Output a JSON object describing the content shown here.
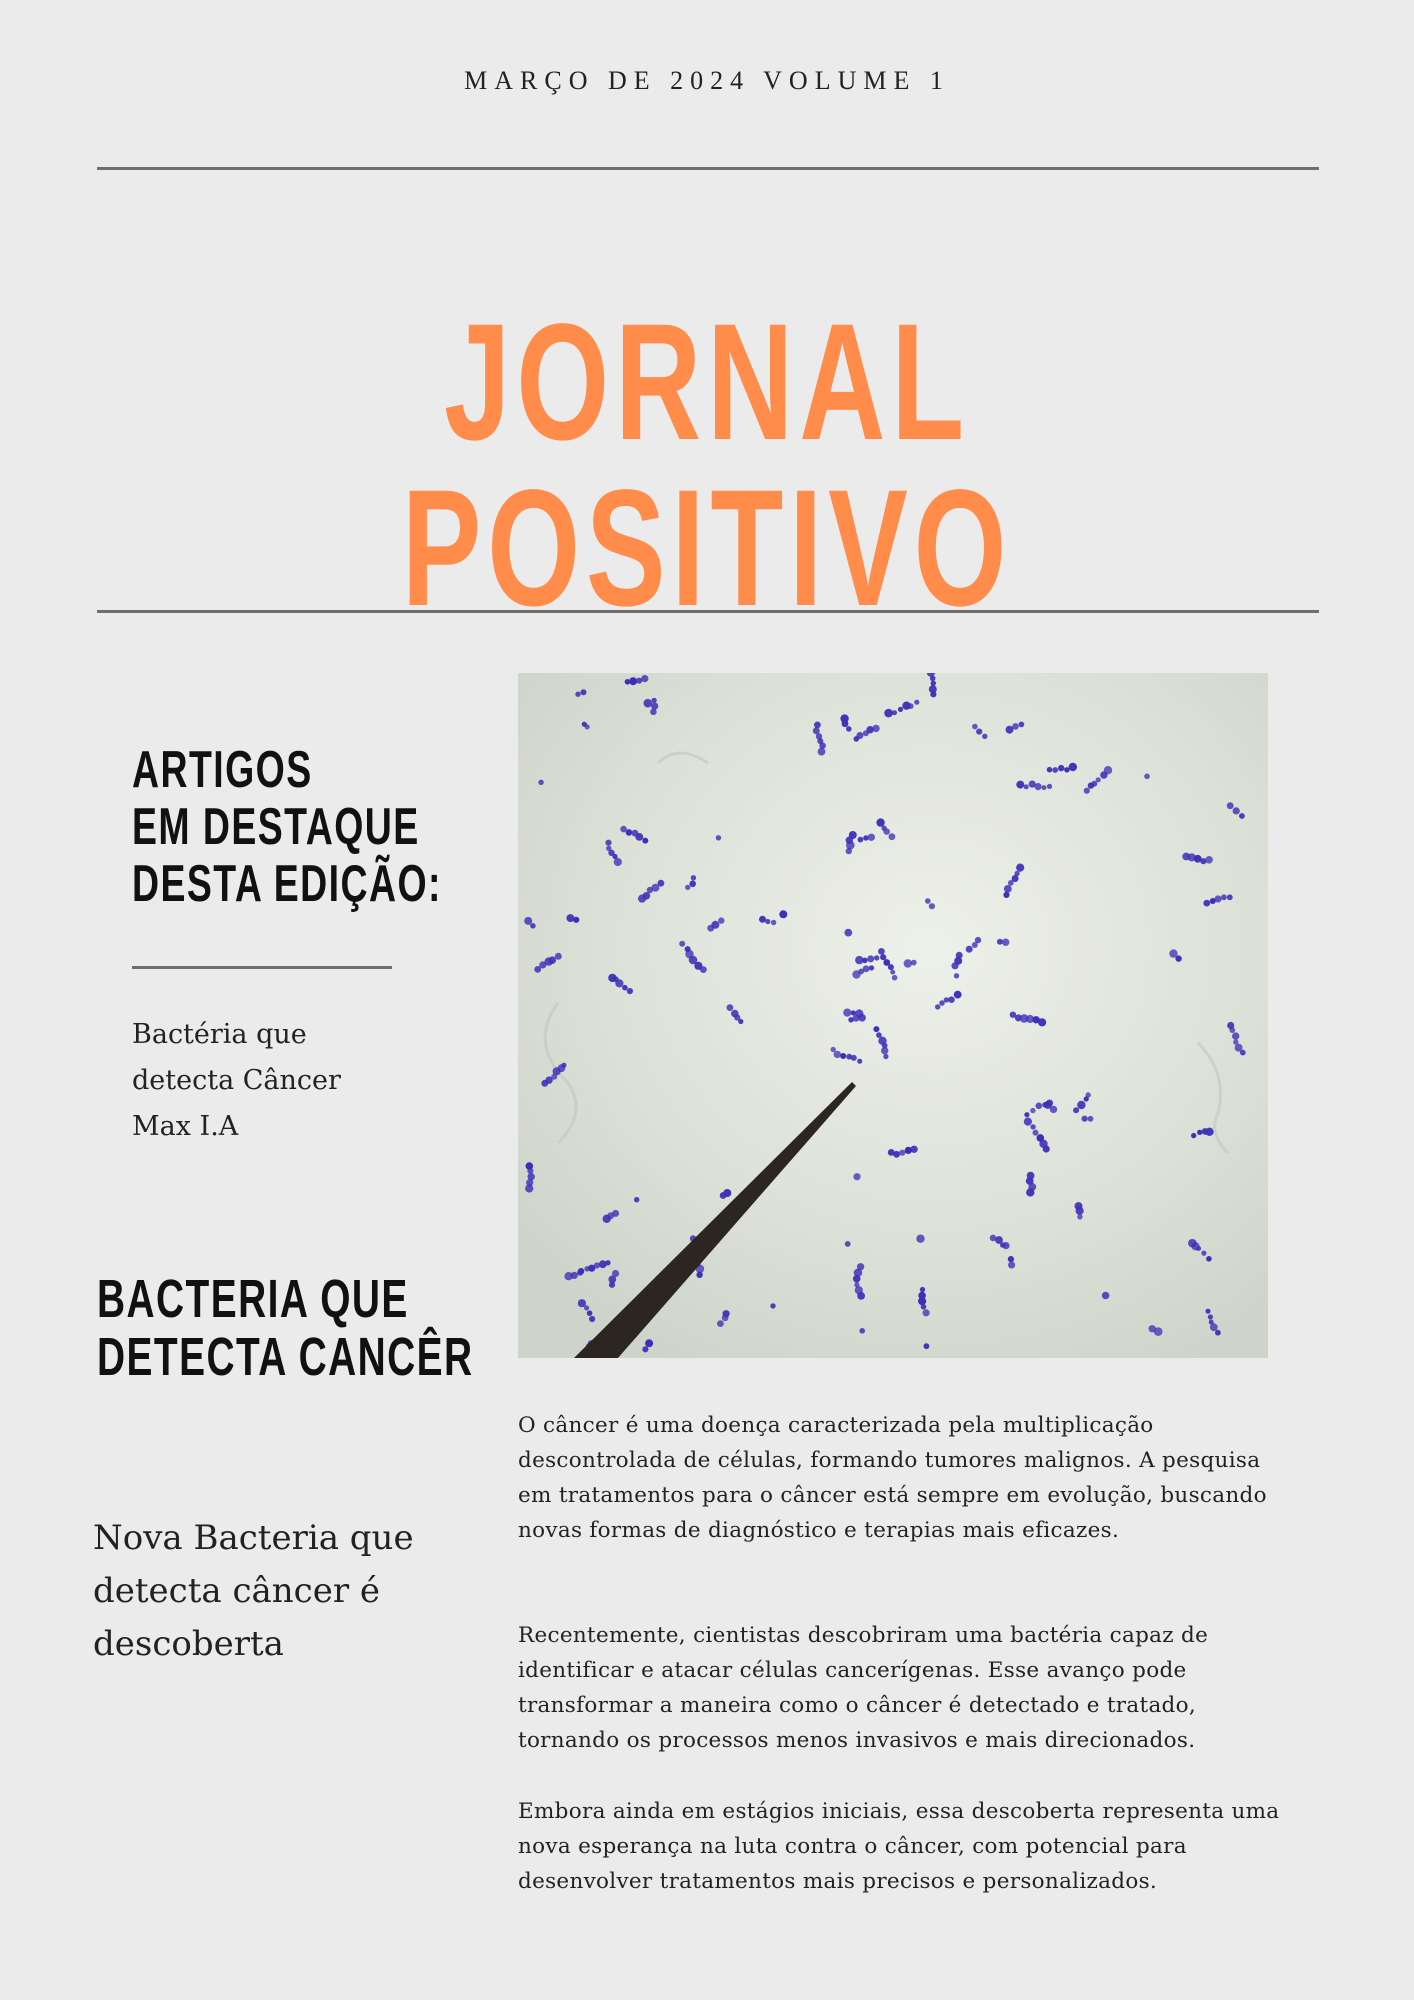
{
  "issue_line": "MARÇO DE 2024 VOLUME 1",
  "masthead": "JORNAL POSITIVO",
  "featured": {
    "heading": [
      "ARTIGOS",
      "EM DESTAQUE",
      "DESTA EDIÇÃO:"
    ],
    "items": [
      "Bactéria que",
      "detecta Câncer",
      "Max I.A"
    ]
  },
  "article": {
    "heading": [
      "BACTERIA QUE",
      "DETECTA CANCÊR"
    ],
    "subtitle": "Nova Bacteria que detecta câncer é descoberta",
    "paragraphs": [
      "O câncer é uma doença caracterizada pela multiplicação descontrolada de células, formando tumores malignos. A pesquisa em tratamentos para o câncer está sempre em evolução, buscando novas formas de diagnóstico e terapias mais eficazes.",
      "Recentemente, cientistas descobriram uma bactéria capaz de identificar e atacar células cancerígenas. Esse avanço pode transformar a maneira como o câncer é detectado e tratado, tornando os processos menos invasivos e mais direcionados.",
      "Embora ainda em estágios iniciais, essa descoberta representa uma nova esperança na luta contra o câncer, com potencial para desenvolver tratamentos mais precisos e personalizados."
    ]
  },
  "colors": {
    "masthead": "#ff8c4a",
    "background": "#ebebeb",
    "rule": "#6e6e6e",
    "bacteria": "#3b2fb8"
  }
}
